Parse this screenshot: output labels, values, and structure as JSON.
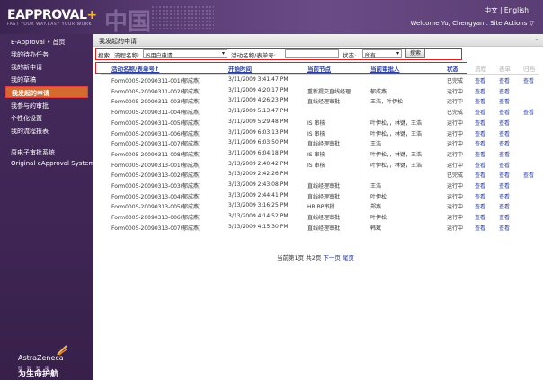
{
  "header": {
    "logo": "EAPPROVAL",
    "logo_plus": "+",
    "slogan": "FAST YOUR WAY.EASY YOUR WORK",
    "lang_chinese": "中文",
    "lang_separator": "|",
    "lang_english": "English",
    "welcome": "Welcome Yu, Chengyan",
    "site_actions": ". Site Actions ▽"
  },
  "sidebar": {
    "items": [
      {
        "label": "E-Approval • 首页"
      },
      {
        "label": "我的待办任务"
      },
      {
        "label": "我的新申请"
      },
      {
        "label": "我的草稿"
      },
      {
        "label": "我发起的申请",
        "active": true
      },
      {
        "label": "我参与的审批"
      },
      {
        "label": "个性化设置"
      },
      {
        "label": "我的流程报表"
      },
      {
        "label": "原电子审批系统"
      },
      {
        "label": "Original eApproval System"
      }
    ],
    "brand": "AstraZeneca",
    "brand_chinese": "阿 斯 利 康",
    "brand_slogan": "为生命护航"
  },
  "main": {
    "title": "我发起的申请",
    "collapse": "-",
    "search": {
      "label": "搜索",
      "process_label": "流程名称:",
      "process_value": "IS用户申请",
      "activity_label": "活动名称/表单号:",
      "activity_value": "",
      "status_label": "状态:",
      "status_value": "所有",
      "button": "搜索"
    },
    "columns": {
      "name": "活动名称/表单号↑",
      "start_time": "开始时间",
      "current_node": "当前节点",
      "current_approver": "当前审批人",
      "status": "状态",
      "process": "流程",
      "form": "表单",
      "archive": "归档"
    },
    "rows": [
      {
        "name": "Form0005-20090311-001(郁成燕)",
        "time": "3/11/2009 3:41:47 PM",
        "node": "",
        "approver": "",
        "status": "已完成",
        "process": "查看",
        "form": "查看",
        "archive": "查看"
      },
      {
        "name": "Form0005-20090311-002(郁成燕)",
        "time": "3/11/2009 4:20:17 PM",
        "node": "重新提交直线经理",
        "approver": "郁成燕",
        "status": "运行中",
        "process": "查看",
        "form": "查看",
        "archive": ""
      },
      {
        "name": "Form0005-20090311-003(郁成燕)",
        "time": "3/11/2009 4:26:23 PM",
        "node": "直线经理审批",
        "approver": "王浩，叶伊松",
        "status": "运行中",
        "process": "查看",
        "form": "查看",
        "archive": ""
      },
      {
        "name": "Form0005-20090311-004(郁成燕)",
        "time": "3/11/2009 5:13:47 PM",
        "node": "",
        "approver": "",
        "status": "已完成",
        "process": "查看",
        "form": "查看",
        "archive": "查看"
      },
      {
        "name": "Form0005-20090311-005(郁成燕)",
        "time": "3/11/2009 5:29:48 PM",
        "node": "IS 审核",
        "approver": "叶伊松，，林键，王浩",
        "status": "运行中",
        "process": "查看",
        "form": "查看",
        "archive": ""
      },
      {
        "name": "Form0005-20090311-006(郁成燕)",
        "time": "3/11/2009 6:03:13 PM",
        "node": "IS 审核",
        "approver": "叶伊松，，林键，王浩",
        "status": "运行中",
        "process": "查看",
        "form": "查看",
        "archive": ""
      },
      {
        "name": "Form0005-20090311-007(郁成燕)",
        "time": "3/11/2009 6:03:50 PM",
        "node": "直线经理审批",
        "approver": "王浩",
        "status": "运行中",
        "process": "查看",
        "form": "查看",
        "archive": ""
      },
      {
        "name": "Form0005-20090311-008(郁成燕)",
        "time": "3/11/2009 6:04:18 PM",
        "node": "IS 审核",
        "approver": "叶伊松，，林键，王浩",
        "status": "运行中",
        "process": "查看",
        "form": "查看",
        "archive": ""
      },
      {
        "name": "Form0005-20090313-001(郁成燕)",
        "time": "3/13/2009 2:40:42 PM",
        "node": "IS 审核",
        "approver": "叶伊松，，林键，王浩",
        "status": "运行中",
        "process": "查看",
        "form": "查看",
        "archive": ""
      },
      {
        "name": "Form0005-20090313-002(郁成燕)",
        "time": "3/13/2009 2:42:26 PM",
        "node": "",
        "approver": "",
        "status": "已完成",
        "process": "查看",
        "form": "查看",
        "archive": "查看"
      },
      {
        "name": "Form0005-20090313-003(郁成燕)",
        "time": "3/13/2009 2:43:08 PM",
        "node": "直线经理审批",
        "approver": "王浩",
        "status": "运行中",
        "process": "查看",
        "form": "查看",
        "archive": ""
      },
      {
        "name": "Form0005-20090313-004(郁成燕)",
        "time": "3/13/2009 2:44:41 PM",
        "node": "直线经理审批",
        "approver": "叶伊松",
        "status": "运行中",
        "process": "查看",
        "form": "查看",
        "archive": ""
      },
      {
        "name": "Form0005-20090313-005(郁成燕)",
        "time": "3/13/2009 3:16:25 PM",
        "node": "HR BP审批",
        "approver": "郑燕",
        "status": "运行中",
        "process": "查看",
        "form": "查看",
        "archive": ""
      },
      {
        "name": "Form0005-20090313-006(郁成燕)",
        "time": "3/13/2009 4:14:52 PM",
        "node": "直线经理审批",
        "approver": "叶伊松",
        "status": "运行中",
        "process": "查看",
        "form": "查看",
        "archive": ""
      },
      {
        "name": "Form0005-20090313-007(郁成燕)",
        "time": "3/13/2009 4:15:30 PM",
        "node": "直线经理审批",
        "approver": "韩斌",
        "status": "运行中",
        "process": "查看",
        "form": "查看",
        "archive": ""
      }
    ],
    "pager": {
      "info": "当前第1页 共2页",
      "next": "下一页",
      "last": "尾页"
    }
  },
  "colors": {
    "header_purple": "#5d3f78",
    "sidebar_purple": "#3e2553",
    "active_orange": "#d46a2e",
    "highlight_red": "#e02020",
    "link_blue": "#2a3fa0"
  }
}
